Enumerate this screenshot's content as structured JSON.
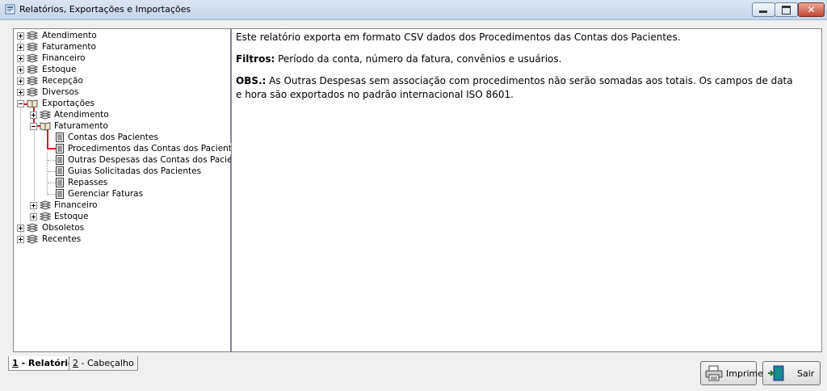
{
  "window": {
    "title": "Relatórios, Exportações e Importações"
  },
  "tree": {
    "top": [
      {
        "label": "Atendimento"
      },
      {
        "label": "Faturamento"
      },
      {
        "label": "Financeiro"
      },
      {
        "label": "Estoque"
      },
      {
        "label": "Recepção"
      },
      {
        "label": "Diversos"
      },
      {
        "label": "Exportações"
      }
    ],
    "exportacoes_children": {
      "atendimento": "Atendimento",
      "faturamento": "Faturamento",
      "financeiro": "Financeiro",
      "estoque": "Estoque"
    },
    "faturamento_reports": [
      "Contas dos Pacientes",
      "Procedimentos das Contas dos Pacientes",
      "Outras Despesas das Contas dos Pacientes",
      "Guias Solicitadas dos Pacientes",
      "Repasses",
      "Gerenciar Faturas"
    ],
    "bottom": [
      "Obsoletos",
      "Recentes"
    ],
    "selected_report": "Procedimentos das Contas dos Pacientes"
  },
  "description": {
    "line1": "Este relatório exporta em formato CSV dados dos Procedimentos das Contas dos Pacientes.",
    "filters_label": "Filtros:",
    "filters_text": " Período da conta, número da fatura, convênios e usuários.",
    "obs_label": "OBS.:",
    "obs_text": " As Outras Despesas sem associação com procedimentos não serão somadas aos totais. Os campos de data e hora são exportados no padrão internacional  ISO 8601."
  },
  "tabs": [
    {
      "key": "1",
      "label": " - Relatório"
    },
    {
      "key": "2",
      "label": " - Cabeçalho"
    }
  ],
  "buttons": {
    "print": "Imprime",
    "exit": "Sair"
  },
  "icons": {
    "node": "books-icon",
    "report": "document-icon",
    "print": "printer-icon",
    "exit": "exit-door-icon"
  },
  "colors": {
    "selection_line": "#d21b2c",
    "title_bar": "#c5d4e8"
  }
}
